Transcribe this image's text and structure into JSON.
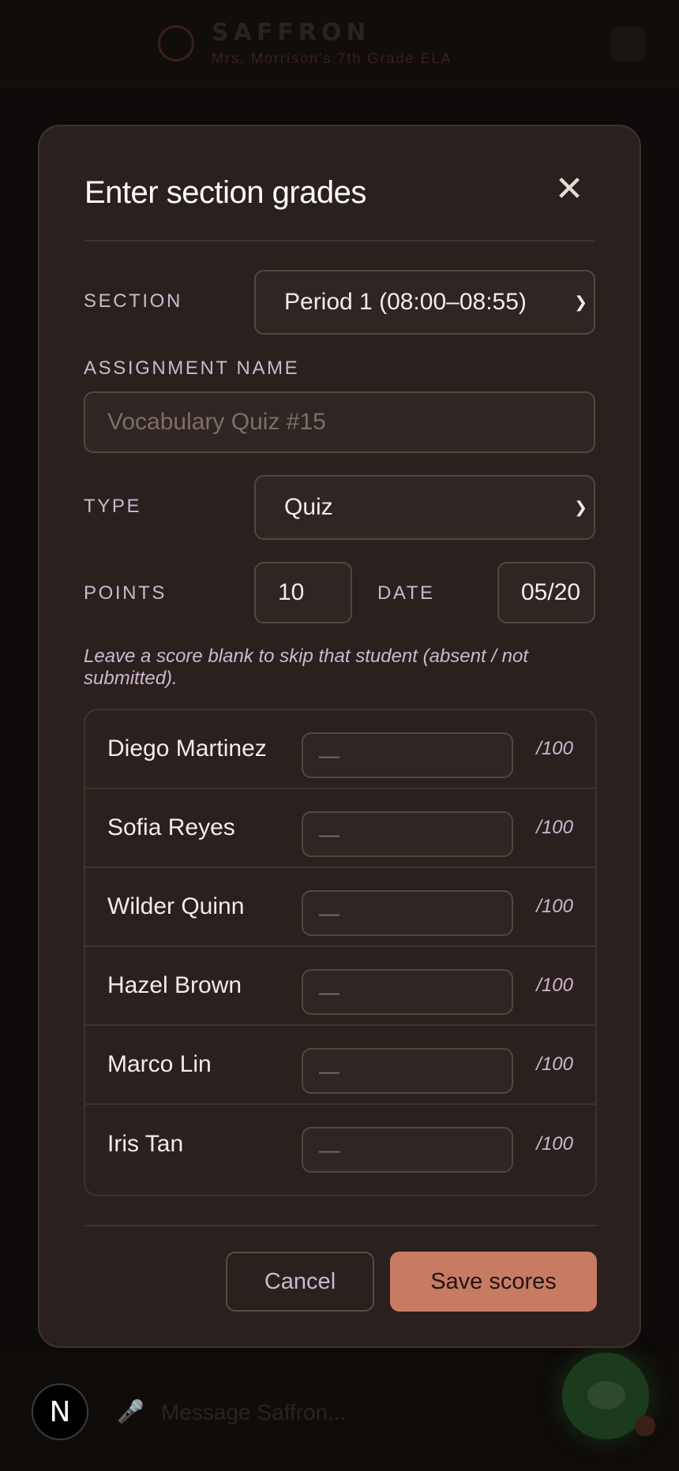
{
  "app": {
    "brand": "SAFFRON",
    "tagline": "Mrs. Morrison's 7th Grade ELA",
    "avatar_letter": "N",
    "composer_placeholder": "Message Saffron..."
  },
  "modal": {
    "title": "Enter section grades",
    "close_glyph": "✕",
    "section": {
      "label": "SECTION",
      "value": "Period 1 (08:00–08:55)"
    },
    "assignment": {
      "label": "ASSIGNMENT NAME",
      "placeholder": "Vocabulary Quiz #15",
      "value": ""
    },
    "type": {
      "label": "TYPE",
      "value": "Quiz"
    },
    "points": {
      "label": "POINTS",
      "value": "10"
    },
    "date": {
      "label": "DATE",
      "value": "05/20"
    },
    "hint": "Leave a score blank to skip that student (absent / not submitted).",
    "score_placeholder": "—",
    "students": [
      {
        "name": "Diego Martinez",
        "max": "/100"
      },
      {
        "name": "Sofia Reyes",
        "max": "/100"
      },
      {
        "name": "Wilder Quinn",
        "max": "/100"
      },
      {
        "name": "Hazel Brown",
        "max": "/100"
      },
      {
        "name": "Marco Lin",
        "max": "/100"
      },
      {
        "name": "Iris Tan",
        "max": "/100"
      }
    ],
    "cancel_label": "Cancel",
    "save_label": "Save scores"
  },
  "colors": {
    "modal_bg": "#2a211e",
    "accent": "#c77b63",
    "label": "#cbb8cf",
    "text": "#f4ecea"
  },
  "icons": {
    "close": "close-icon",
    "select": "chevron-down-icon",
    "mic": "microphone-icon",
    "fab": "chat-bubble-icon"
  }
}
